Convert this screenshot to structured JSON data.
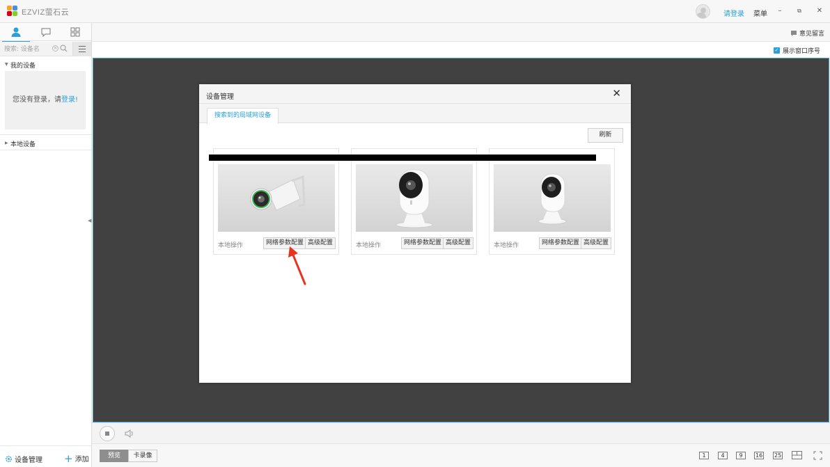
{
  "app": {
    "brand": "EZVIZ萤石云",
    "login_link": "请登录",
    "menu_label": "菜单",
    "min_label": "–",
    "restore_label": "⧉",
    "close_label": "✕"
  },
  "sidebar": {
    "search_placeholder": "搜索: 设备名",
    "my_devices_label": "我的设备",
    "login_prompt_text": "您没有登录，请",
    "login_prompt_link": "登录!",
    "local_devices_label": "本地设备",
    "device_manage_label": "设备管理",
    "add_label": "添加"
  },
  "toolbar": {
    "feedback_label": "意见留言",
    "show_index_label": "展示窗口序号"
  },
  "bottom": {
    "tab_preview": "预览",
    "tab_card": "卡录像",
    "layouts": [
      "1",
      "4",
      "9",
      "16",
      "25"
    ]
  },
  "dialog": {
    "title": "设备管理",
    "tab_label": "搜索到的局域网设备",
    "refresh_label": "刷新",
    "cards": [
      {
        "local_op": "本地操作",
        "net_btn": "网络参数配置",
        "adv_btn": "高级配置"
      },
      {
        "local_op": "本地操作",
        "net_btn": "网络参数配置",
        "adv_btn": "高级配置"
      },
      {
        "local_op": "本地操作",
        "net_btn": "网络参数配置",
        "adv_btn": "高级配置"
      }
    ]
  },
  "colors": {
    "accent": "#2a9fd8",
    "viewport_bg": "#414141",
    "annotation_arrow": "#e8341c"
  }
}
